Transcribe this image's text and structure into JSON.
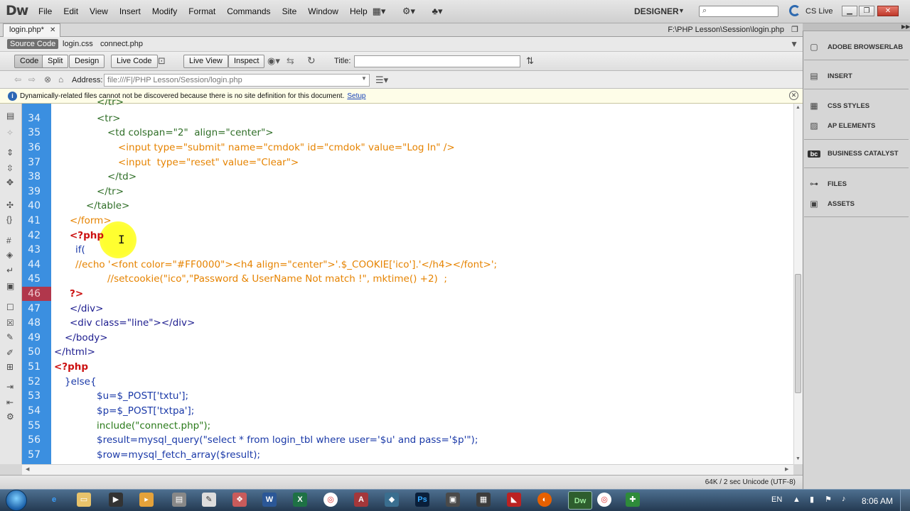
{
  "app": {
    "logo": "Dw",
    "menus": [
      "File",
      "Edit",
      "View",
      "Insert",
      "Modify",
      "Format",
      "Commands",
      "Site",
      "Window",
      "Help"
    ],
    "workspace": "DESIGNER",
    "cs_live": "CS Live"
  },
  "document": {
    "tab_label": "login.php*",
    "path": "F:\\PHP Lesson\\Session\\login.php",
    "related_files": [
      "Source Code",
      "login.css",
      "connect.php"
    ]
  },
  "toolbar": {
    "code": "Code",
    "split": "Split",
    "design": "Design",
    "live_code": "Live Code",
    "live_view": "Live View",
    "inspect": "Inspect",
    "title_label": "Title:",
    "title_value": ""
  },
  "address": {
    "label": "Address:",
    "value": "file:///F|/PHP Lesson/Session/login.php"
  },
  "info": {
    "message": "Dynamically-related files cannot not be discovered because there is no site definition for this document.",
    "link": "Setup"
  },
  "code": {
    "partial_line": "</tr>",
    "lines": [
      {
        "n": "34",
        "text": "<tr>"
      },
      {
        "n": "35",
        "text": "<td colspan=\"2\"  align=\"center\">"
      },
      {
        "n": "36",
        "text": "<input type=\"submit\" name=\"cmdok\" id=\"cmdok\" value=\"Log In\" />"
      },
      {
        "n": "37",
        "text": "<input  type=\"reset\" value=\"Clear\">"
      },
      {
        "n": "38",
        "text": "</td>"
      },
      {
        "n": "39",
        "text": "</tr>"
      },
      {
        "n": "40",
        "text": "</table>"
      },
      {
        "n": "41",
        "text": "</form>"
      },
      {
        "n": "42",
        "text": "<?php"
      },
      {
        "n": "43",
        "text": "if("
      },
      {
        "n": "44",
        "text": "//echo '<font color=\"#FF0000\"><h4 align=\"center\">'.$_COOKIE['ico'].'</h4></font>';"
      },
      {
        "n": "45",
        "text": "//setcookie(\"ico\",\"Password & UserName Not match !\", mktime() +2)  ;"
      },
      {
        "n": "46",
        "text": "?>"
      },
      {
        "n": "47",
        "text": "</div>"
      },
      {
        "n": "48",
        "text": "<div class=\"line\"></div>"
      },
      {
        "n": "49",
        "text": "</body>"
      },
      {
        "n": "50",
        "text": "</html>"
      },
      {
        "n": "51",
        "text": "<?php"
      },
      {
        "n": "52",
        "text": "}else{"
      },
      {
        "n": "53",
        "text": "$u=$_POST['txtu'];"
      },
      {
        "n": "54",
        "text": "$p=$_POST['txtpa'];"
      },
      {
        "n": "55",
        "text": "include(\"connect.php\");"
      },
      {
        "n": "56",
        "text": "$result=mysql_query(\"select * from login_tbl where user='$u' and pass='$p'\");"
      },
      {
        "n": "57",
        "text": "$row=mysql_fetch_array($result);"
      }
    ]
  },
  "status": {
    "text": "64K / 2 sec  Unicode (UTF-8)"
  },
  "panel": {
    "items": [
      {
        "label": "ADOBE BROWSERLAB",
        "icon": "browserlab-icon"
      },
      {
        "label": "INSERT",
        "icon": "insert-icon"
      },
      {
        "label": "CSS STYLES",
        "icon": "css-styles-icon"
      },
      {
        "label": "AP ELEMENTS",
        "icon": "ap-elements-icon"
      },
      {
        "label": "BUSINESS CATALYST",
        "icon": "business-catalyst-icon"
      },
      {
        "label": "FILES",
        "icon": "files-icon"
      },
      {
        "label": "ASSETS",
        "icon": "assets-icon"
      }
    ]
  },
  "taskbar": {
    "language": "EN",
    "time": "8:06 AM"
  }
}
